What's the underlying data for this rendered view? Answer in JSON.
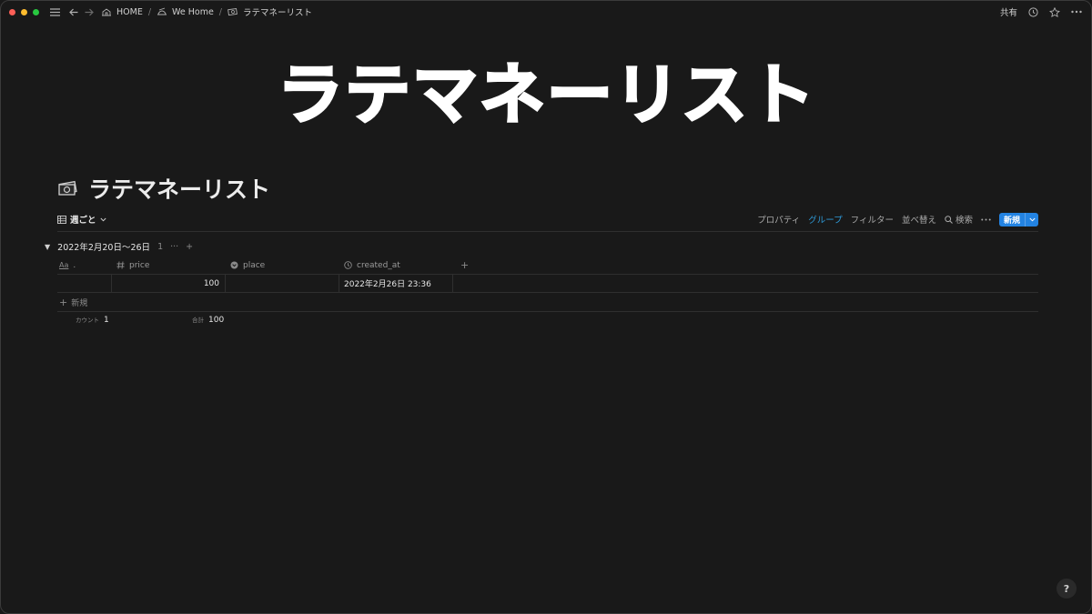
{
  "window": {
    "breadcrumbs": [
      {
        "label": "HOME",
        "icon": "house-sketch-icon"
      },
      {
        "label": "We Home",
        "icon": "dishes-icon"
      },
      {
        "label": "ラテマネーリスト",
        "icon": "money-bills-icon"
      }
    ],
    "right": {
      "share_label": "共有"
    }
  },
  "cover": {
    "title": "ラテマネーリスト"
  },
  "page": {
    "title": "ラテマネーリスト",
    "icon": "money-bills-icon"
  },
  "view": {
    "tab_label": "週ごと",
    "actions": {
      "properties": "プロパティ",
      "group": "グループ",
      "filter": "フィルター",
      "sort": "並べ替え",
      "search": "検索",
      "new": "新規"
    },
    "accent_color": "#2383e2"
  },
  "group": {
    "label": "2022年2月20日〜26日",
    "count": "1",
    "more": "···",
    "add": "+"
  },
  "table": {
    "columns": [
      {
        "label": ".",
        "icon": "text-icon"
      },
      {
        "label": "price",
        "icon": "number-icon"
      },
      {
        "label": "place",
        "icon": "select-icon"
      },
      {
        "label": "created_at",
        "icon": "clock-icon"
      }
    ],
    "rows": [
      {
        "title": "",
        "price": "100",
        "place": "",
        "created_at": "2022年2月26日 23:36"
      }
    ],
    "add_column": "+",
    "new_row_label": "新規",
    "calc": {
      "count_label": "カウント",
      "count_value": "1",
      "sum_label": "合計",
      "sum_value": "100"
    }
  },
  "help": {
    "label": "?"
  }
}
